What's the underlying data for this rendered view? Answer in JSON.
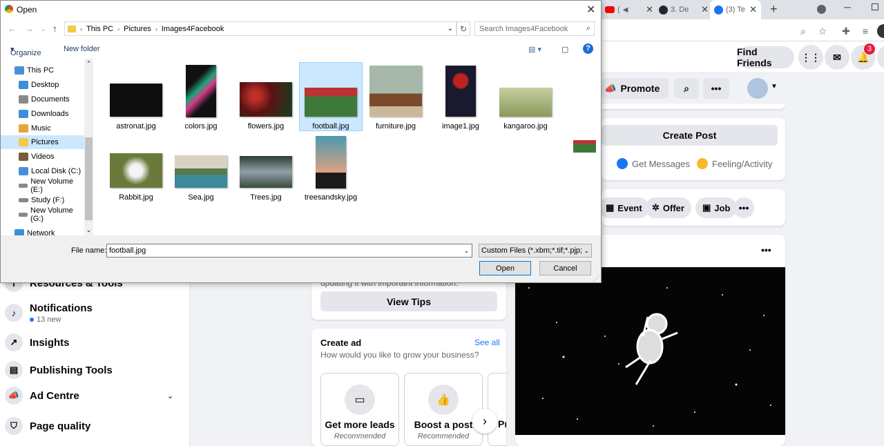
{
  "chrome": {
    "tabs": [
      {
        "label": "(",
        "icon": "youtube-icon"
      },
      {
        "label": "3. De",
        "icon": "github-icon"
      },
      {
        "label": "(3) Te",
        "icon": "facebook-icon"
      }
    ],
    "new_tab": "+"
  },
  "facebook": {
    "header": {
      "find_friends": "Find Friends",
      "notification_count": "3"
    },
    "top_actions": {
      "promote": "Promote"
    },
    "create_post": {
      "button": "Create Post",
      "get_messages": "Get Messages",
      "feeling": "Feeling/Activity"
    },
    "actions": {
      "event": "Event",
      "offer": "Offer",
      "job": "Job"
    },
    "left_nav": [
      {
        "label": "Resources & Tools"
      },
      {
        "label": "Notifications",
        "sub": "13 new"
      },
      {
        "label": "Insights"
      },
      {
        "label": "Publishing Tools"
      },
      {
        "label": "Ad Centre"
      },
      {
        "label": "Page quality"
      }
    ],
    "tips": {
      "text": "updating it with important information.",
      "button": "View Tips"
    },
    "create_ad": {
      "title": "Create ad",
      "see_all": "See all",
      "subtitle": "How would you like to grow your business?",
      "options": [
        {
          "title": "Get more leads",
          "sub": "Recommended"
        },
        {
          "title": "Boost a post",
          "sub": "Recommended"
        },
        {
          "title": "Pr",
          "sub": ""
        }
      ]
    }
  },
  "dialog": {
    "title": "Open",
    "breadcrumb": [
      "This PC",
      "Pictures",
      "Images4Facebook"
    ],
    "search_placeholder": "Search Images4Facebook",
    "organize": "Organize",
    "new_folder": "New folder",
    "tree": [
      {
        "label": "This PC",
        "color": "#4a90d9"
      },
      {
        "label": "Desktop",
        "color": "#3c8ed9"
      },
      {
        "label": "Documents",
        "color": "#8a8a8a"
      },
      {
        "label": "Downloads",
        "color": "#3c8ed9"
      },
      {
        "label": "Music",
        "color": "#e8a33a"
      },
      {
        "label": "Pictures",
        "color": "#f3c94a"
      },
      {
        "label": "Videos",
        "color": "#7a5c3a"
      },
      {
        "label": "Local Disk (C:)",
        "color": "#4a90d9"
      },
      {
        "label": "New Volume (E:)",
        "color": "#888888"
      },
      {
        "label": "Study (F:)",
        "color": "#888888"
      },
      {
        "label": "New Volume (G:)",
        "color": "#888888"
      },
      {
        "label": "Network",
        "color": "#3c8ed9"
      }
    ],
    "files": [
      {
        "name": "astronat.jpg",
        "color": "#0d0d0d"
      },
      {
        "name": "colors.jpg",
        "color": "#111"
      },
      {
        "name": "flowers.jpg",
        "color": "#7a1a1a"
      },
      {
        "name": "football.jpg",
        "color": "#3d7a3a"
      },
      {
        "name": "furniture.jpg",
        "color": "#8fa595"
      },
      {
        "name": "image1.jpg",
        "color": "#1a1a2e"
      },
      {
        "name": "kangaroo.jpg",
        "color": "#9aab72"
      },
      {
        "name": "Rabbit.jpg",
        "color": "#8a9a5a"
      },
      {
        "name": "Sea.jpg",
        "color": "#6b8f6a"
      },
      {
        "name": "Trees.jpg",
        "color": "#4a5a4a"
      },
      {
        "name": "treesandsky.jpg",
        "color": "#c07a5a"
      }
    ],
    "file_name_label": "File name:",
    "file_name_value": "football.jpg",
    "file_type": "Custom Files (*.xbm;*.tif;*.pjp;*.j",
    "open": "Open",
    "cancel": "Cancel"
  }
}
